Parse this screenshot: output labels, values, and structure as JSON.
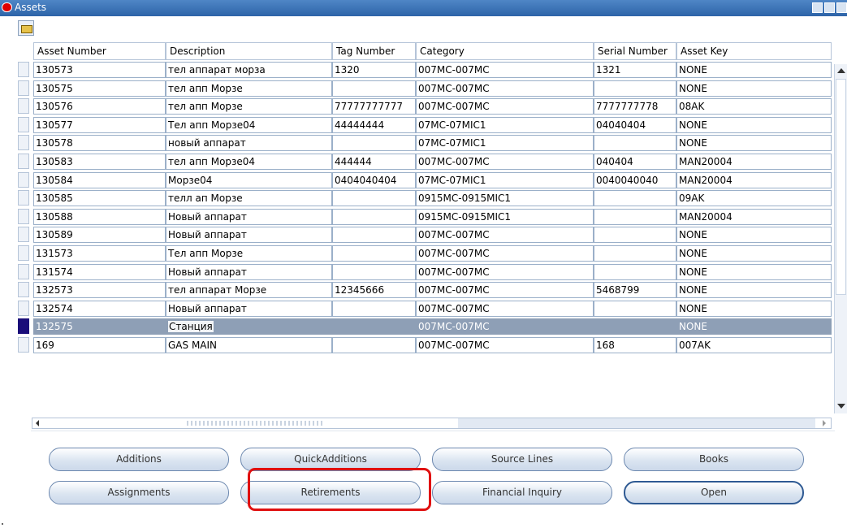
{
  "window": {
    "title": "Assets"
  },
  "columns": [
    "Asset Number",
    "Description",
    "Tag Number",
    "Category",
    "Serial Number",
    "Asset Key"
  ],
  "rows": [
    [
      "130573",
      "тел аппарат морза",
      "1320",
      "007MC-007MC",
      "1321",
      "NONE"
    ],
    [
      "130575",
      "тел апп Морзе",
      "",
      "007MC-007MC",
      "",
      "NONE"
    ],
    [
      "130576",
      "тел апп Морзе",
      "77777777777",
      "007MC-007MC",
      "7777777778",
      "08AK"
    ],
    [
      "130577",
      "Тел апп Морзе04",
      "44444444",
      "07MC-07MIC1",
      "04040404",
      "NONE"
    ],
    [
      "130578",
      "новый аппарат",
      "",
      "07MC-07MIC1",
      "",
      "NONE"
    ],
    [
      "130583",
      "тел апп Морзе04",
      "444444",
      "007MC-007MC",
      "040404",
      "MAN20004"
    ],
    [
      "130584",
      "Морзе04",
      "0404040404",
      "07MC-07MIC1",
      "0040040040",
      "MAN20004"
    ],
    [
      "130585",
      "телл ап Морзе",
      "",
      "0915MC-0915MIC1",
      "",
      "09AK"
    ],
    [
      "130588",
      "Новый аппарат",
      "",
      "0915MC-0915MIC1",
      "",
      "MAN20004"
    ],
    [
      "130589",
      "Новый аппарат",
      "",
      "007MC-007MC",
      "",
      "NONE"
    ],
    [
      "131573",
      "Тел апп Морзе",
      "",
      "007MC-007MC",
      "",
      "NONE"
    ],
    [
      "131574",
      "Новый аппарат",
      "",
      "007MC-007MC",
      "",
      "NONE"
    ],
    [
      "132573",
      "тел аппарат Морзе",
      "12345666",
      "007MC-007MC",
      "5468799",
      "NONE"
    ],
    [
      "132574",
      "Новый аппарат",
      "",
      "007MC-007MC",
      "",
      "NONE"
    ],
    [
      "132575",
      "Станция",
      "",
      "007MC-007MC",
      "",
      "NONE"
    ],
    [
      "169",
      "GAS MAIN",
      "",
      "007MC-007MC",
      "168",
      "007AK"
    ]
  ],
  "current_row_index": 14,
  "buttons": {
    "additions": "Additions",
    "quick_additions": "QuickAdditions",
    "source_lines": "Source Lines",
    "books": "Books",
    "assignments": "Assignments",
    "retirements": "Retirements",
    "financial_inquiry": "Financial Inquiry",
    "open": "Open"
  },
  "colors": {
    "titlebar": "#3a72b8",
    "current_row": "#8e9fb6",
    "record_indicator": "#1a0d7a",
    "highlight": "#e01010"
  }
}
